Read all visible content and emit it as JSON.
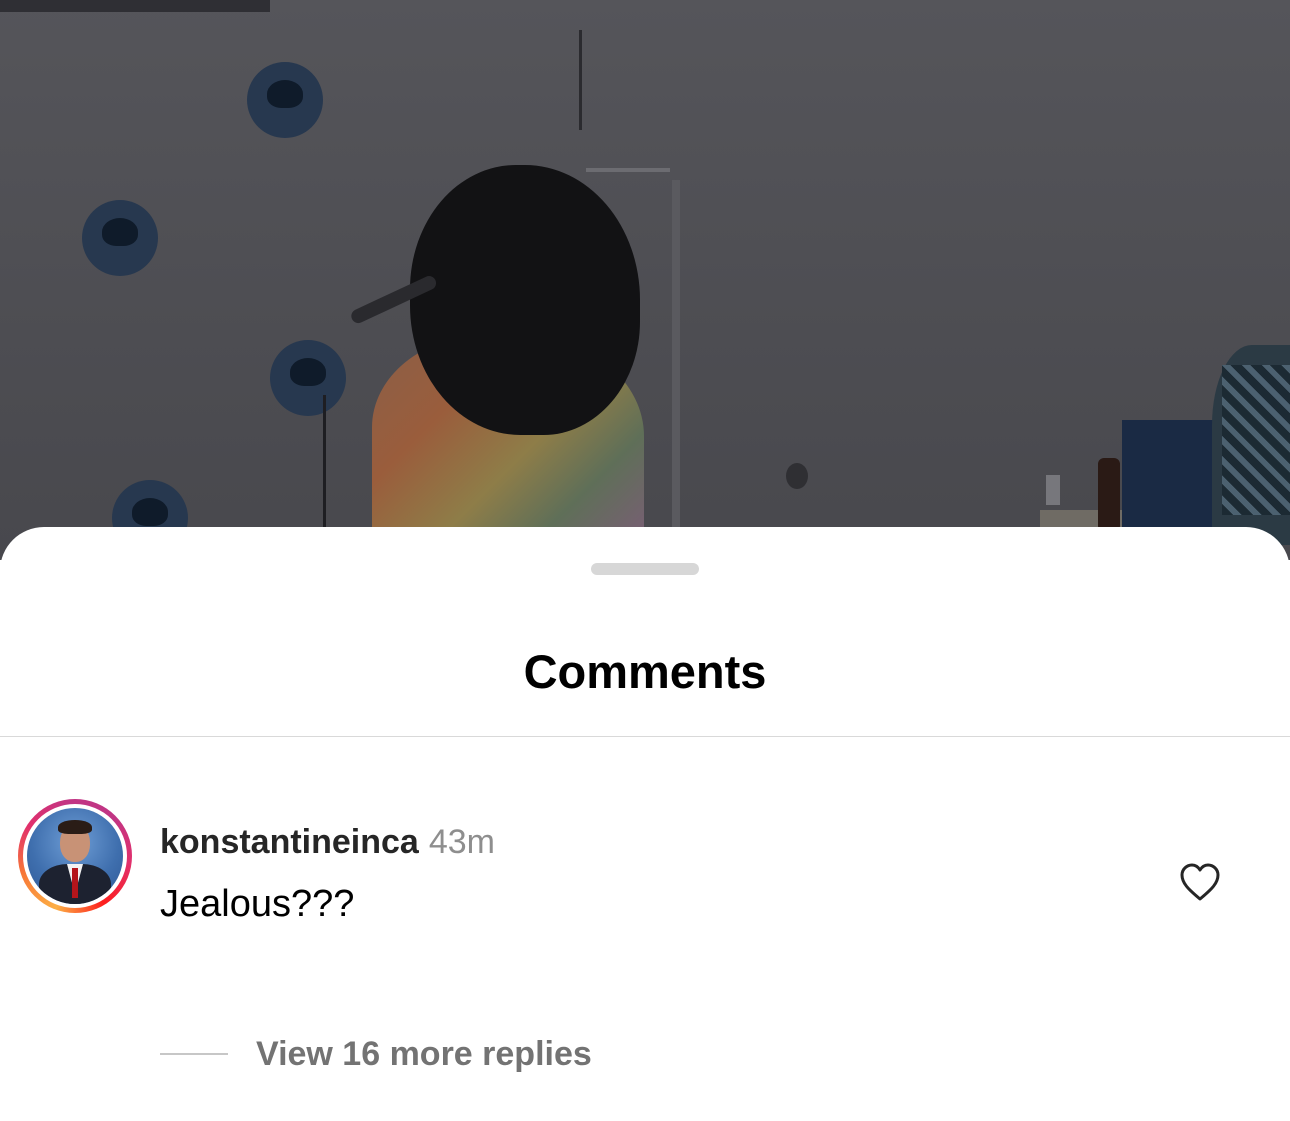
{
  "sheet": {
    "title": "Comments"
  },
  "comment": {
    "username": "konstantineinca",
    "timestamp": "43m",
    "text": "Jealous???",
    "avatar_icon": "profile-photo",
    "like_icon": "heart-outline-icon",
    "story_ring_colors": [
      "#fcaf45",
      "#f77737",
      "#e1306c",
      "#c13584"
    ]
  },
  "replies": {
    "label": "View 16 more replies"
  },
  "colors": {
    "sheet_background": "#ffffff",
    "title_text": "#000000",
    "username_text": "#262626",
    "secondary_text": "#8e8e8e",
    "divider": "#d9d9d9",
    "grabber": "#d7d7d7"
  }
}
